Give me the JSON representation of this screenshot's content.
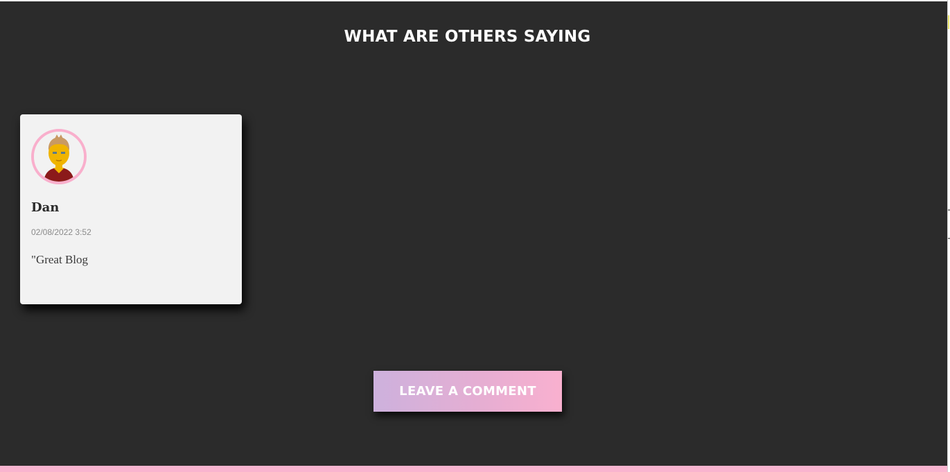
{
  "section": {
    "heading": "WHAT ARE OTHERS SAYING"
  },
  "comments": [
    {
      "name": "Dan",
      "date": "02/08/2022 3:52",
      "text": "\"Great Blog",
      "avatar_icon": "male-avatar-icon"
    }
  ],
  "cta": {
    "label": "LEAVE A COMMENT"
  },
  "colors": {
    "background": "#2b2b2b",
    "card": "#f2f2f2",
    "accent_pink": "#f9b0cf",
    "accent_lavender": "#cdb1dd"
  }
}
